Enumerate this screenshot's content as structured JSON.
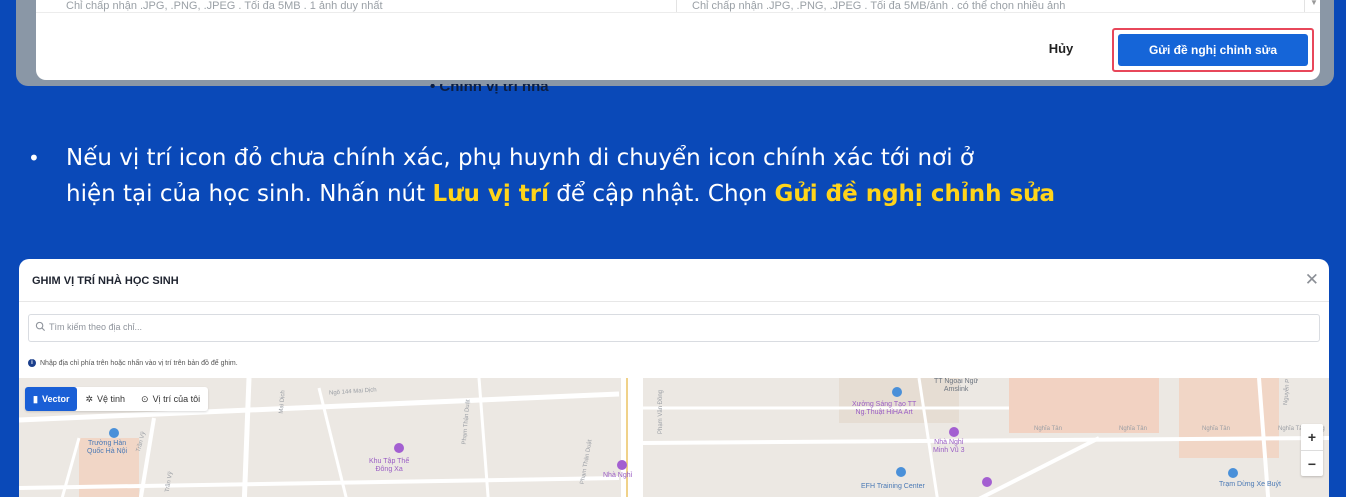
{
  "top_dialog": {
    "hint_left": "Chỉ chấp nhận .JPG, .PNG, .JPEG . Tối đa 5MB . 1 ảnh duy nhất",
    "hint_right": "Chỉ chấp nhận .JPG, .PNG, .JPEG . Tối đa 5MB/ảnh . có thể chọn nhiều ảnh",
    "cancel_label": "Hủy",
    "submit_label": "Gửi đề nghị chỉnh sửa",
    "peek_text": "• Chỉnh vị trí nhà"
  },
  "instruction": {
    "part1": "Nếu vị trí icon đỏ chưa chính xác, phụ huynh di chuyển icon chính xác tới nơi ở",
    "part2": "hiện tại của học sinh. Nhấn nút ",
    "highlight1": "Lưu vị trí",
    "part3": " để cập nhật. Chọn ",
    "highlight2": "Gửi đề nghị chỉnh sửa",
    "highlight_color": "#ffd41a"
  },
  "map_dialog": {
    "title": "GHIM VỊ TRÍ NHÀ HỌC SINH",
    "close_icon": "close-icon",
    "search_placeholder": "Tìm kiếm theo địa chỉ...",
    "info_text": "Nhập địa chỉ phía trên hoặc nhấn vào vị trí trên bản đồ để ghim.",
    "toolbar": {
      "vector_label": "Vector",
      "satellite_label": "Vệ tinh",
      "my_location_label": "Vị trí của tôi"
    },
    "zoom_in": "+",
    "zoom_out": "−",
    "map_labels": {
      "school": "Trường Hàn\nQuốc Hà Nội",
      "ngo144": "Ngõ 144 Mai Dịch",
      "mai_dich": "Mai Dịch",
      "tran_vy": "Trần Vỹ",
      "tran_vy2": "Trần Vỹ",
      "khu_tap_the": "Khu Tập Thể\nĐông Xa",
      "pham_than_duat": "Phạm Thận Duật",
      "pham_van_dong": "Phạm Văn Đồng",
      "nha_nghi": "Nhà Nghỉ",
      "xuong": "Xưởng Sáng Tạo TT\nNg.Thuật HiHA Art",
      "nha_nghi_minh_vu": "Nhà Nghỉ\nMinh Vũ 3",
      "ngoai_ngu": "TT Ngoại Ngữ\nAmslink",
      "efh": "EFH Training Center",
      "nghia_tan1": "Nghĩa Tân",
      "nghia_tan2": "Nghĩa Tân",
      "nghia_tan3": "Nghĩa Tân",
      "nghia_tan4": "Nghĩa Tân",
      "nguyen_p": "Nguyễn P",
      "tram_dung": "Trạm Dừng Xe Buýt",
      "ng": "Ng"
    }
  },
  "colors": {
    "background": "#0a49b8",
    "primary_button": "#1565d8",
    "highlight_border": "#e8475a",
    "map_bg": "#ece8e3",
    "road": "#ffffff",
    "block": "#f5c9b3",
    "poi_purple": "#a35fd1",
    "poi_blue": "#4a90d9"
  }
}
